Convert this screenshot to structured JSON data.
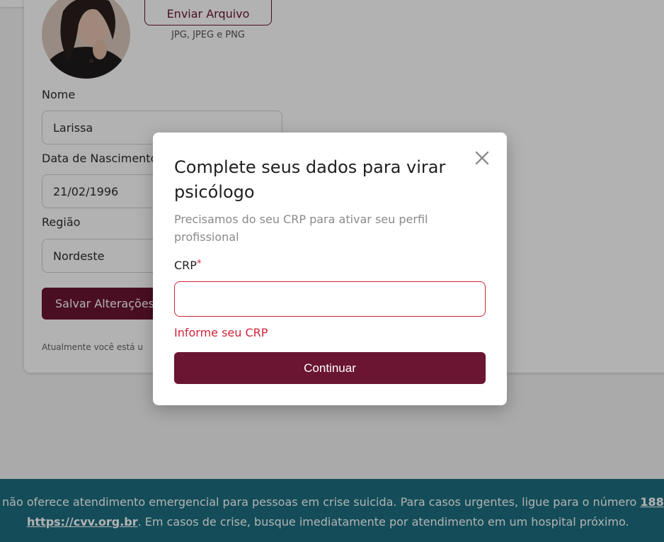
{
  "profile": {
    "upload_button_label": "Enviar Arquivo",
    "upload_hint": "JPG, JPEG e PNG",
    "name_label": "Nome",
    "name_value": "Larissa",
    "birthdate_label": "Data de Nascimento",
    "birthdate_value": "21/02/1996",
    "region_label": "Região",
    "region_value": "Nordeste",
    "save_button_label": "Salvar Alterações",
    "status_note": "Atualmente você está u"
  },
  "modal": {
    "title": "Complete seus dados para virar psicólogo",
    "subtitle": "Precisamos do seu CRP para ativar seu perfil profissional",
    "crp_label": "CRP",
    "required_marker": "*",
    "crp_value": "",
    "crp_error": "Informe seu CRP",
    "continue_label": "Continuar",
    "close_icon": "close-icon"
  },
  "footer": {
    "line1_text": " não oferece atendimento emergencial para pessoas em crise suicida. Para casos urgentes, ligue para o número ",
    "line1_link": "188",
    "line2_link": "https://cvv.org.br",
    "line2_text": ". Em casos de crise, busque imediatamente por atendimento em um hospital próximo."
  },
  "colors": {
    "brand": "#6a1531",
    "error": "#d1243a",
    "footer_bg": "#1d6f80",
    "overlay": "rgba(0,0,0,0.30)"
  }
}
